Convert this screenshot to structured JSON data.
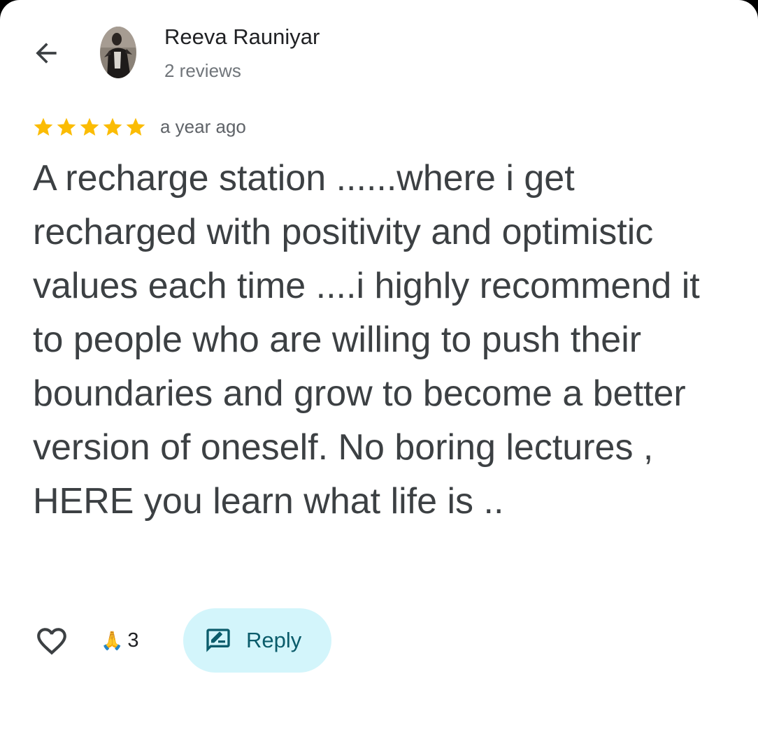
{
  "reviewer": {
    "name": "Reeva Rauniyar",
    "review_count": "2 reviews"
  },
  "review": {
    "rating": 5,
    "rating_max": 5,
    "time": "a year ago",
    "text": "A recharge station ......where i get recharged with positivity and optimistic values each time ....i highly recommend it to people who are willing to push their boundaries and grow to become a better version of oneself. No boring lectures , HERE you learn what life is .."
  },
  "actions": {
    "like_icon": "heart-outline-icon",
    "reaction_emoji": "🙏",
    "reaction_count": "3",
    "reply_label": "Reply",
    "reply_icon": "rate-review-icon"
  },
  "navigation": {
    "back_icon": "arrow-back-icon"
  },
  "colors": {
    "star": "#FBBC04",
    "reply_bg": "#D3F5FB",
    "reply_text": "#0B5C6B",
    "body_text": "#3C4043"
  }
}
